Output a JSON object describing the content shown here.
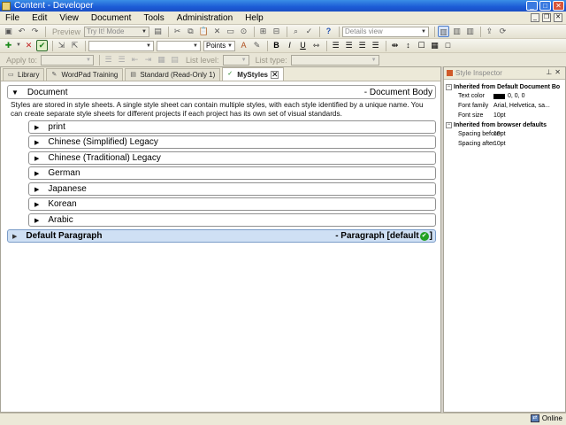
{
  "window": {
    "title": "Content - Developer"
  },
  "menu": [
    "File",
    "Edit",
    "View",
    "Document",
    "Tools",
    "Administration",
    "Help"
  ],
  "toolbar1": {
    "preview_label": "Preview",
    "mode_combo": "Try It! Mode",
    "view_combo": "Details view"
  },
  "toolbar2": {
    "units_combo": "Points",
    "bold": "B",
    "italic": "I",
    "underline": "U"
  },
  "toolbar3": {
    "apply_to_label": "Apply to:",
    "list_level_label": "List level:",
    "list_type_label": "List type:"
  },
  "tabs": [
    {
      "label": "Library",
      "icon": "book-icon",
      "active": false
    },
    {
      "label": "WordPad Training",
      "icon": "wordpad-icon",
      "active": false
    },
    {
      "label": "Standard (Read-Only 1)",
      "icon": "document-icon",
      "active": false
    },
    {
      "label": "MyStyles",
      "icon": "style-icon",
      "active": true
    }
  ],
  "document": {
    "title": "Document",
    "style_type": "- Document Body",
    "description": "Styles are stored in style sheets. A single style sheet can contain multiple styles, with each style identified by a unique name. You can create separate style sheets for different projects if each project has its own set of visual standards."
  },
  "style_sheets": [
    "print",
    "Chinese (Simplified) Legacy",
    "Chinese (Traditional) Legacy",
    "German",
    "Japanese",
    "Korean",
    "Arabic"
  ],
  "default_paragraph": {
    "name": "Default Paragraph",
    "style_type": "- Paragraph [default",
    "suffix": "]"
  },
  "inspector": {
    "title": "Style Inspector",
    "group1": "Inherited from Default Document Bo",
    "props1": [
      {
        "key": "Text color",
        "value": "0, 0, 0"
      },
      {
        "key": "Font family",
        "value": "Arial, Helvetica, sa..."
      },
      {
        "key": "Font size",
        "value": "10pt"
      }
    ],
    "group2": "Inherited from browser defaults",
    "props2": [
      {
        "key": "Spacing before",
        "value": "10pt"
      },
      {
        "key": "Spacing after",
        "value": "10pt"
      }
    ]
  },
  "status": {
    "online": "Online"
  },
  "colors": {
    "titlebar": "#1c5bd6",
    "highlight_row": "#cfe0f4",
    "check_green": "#22a022"
  }
}
